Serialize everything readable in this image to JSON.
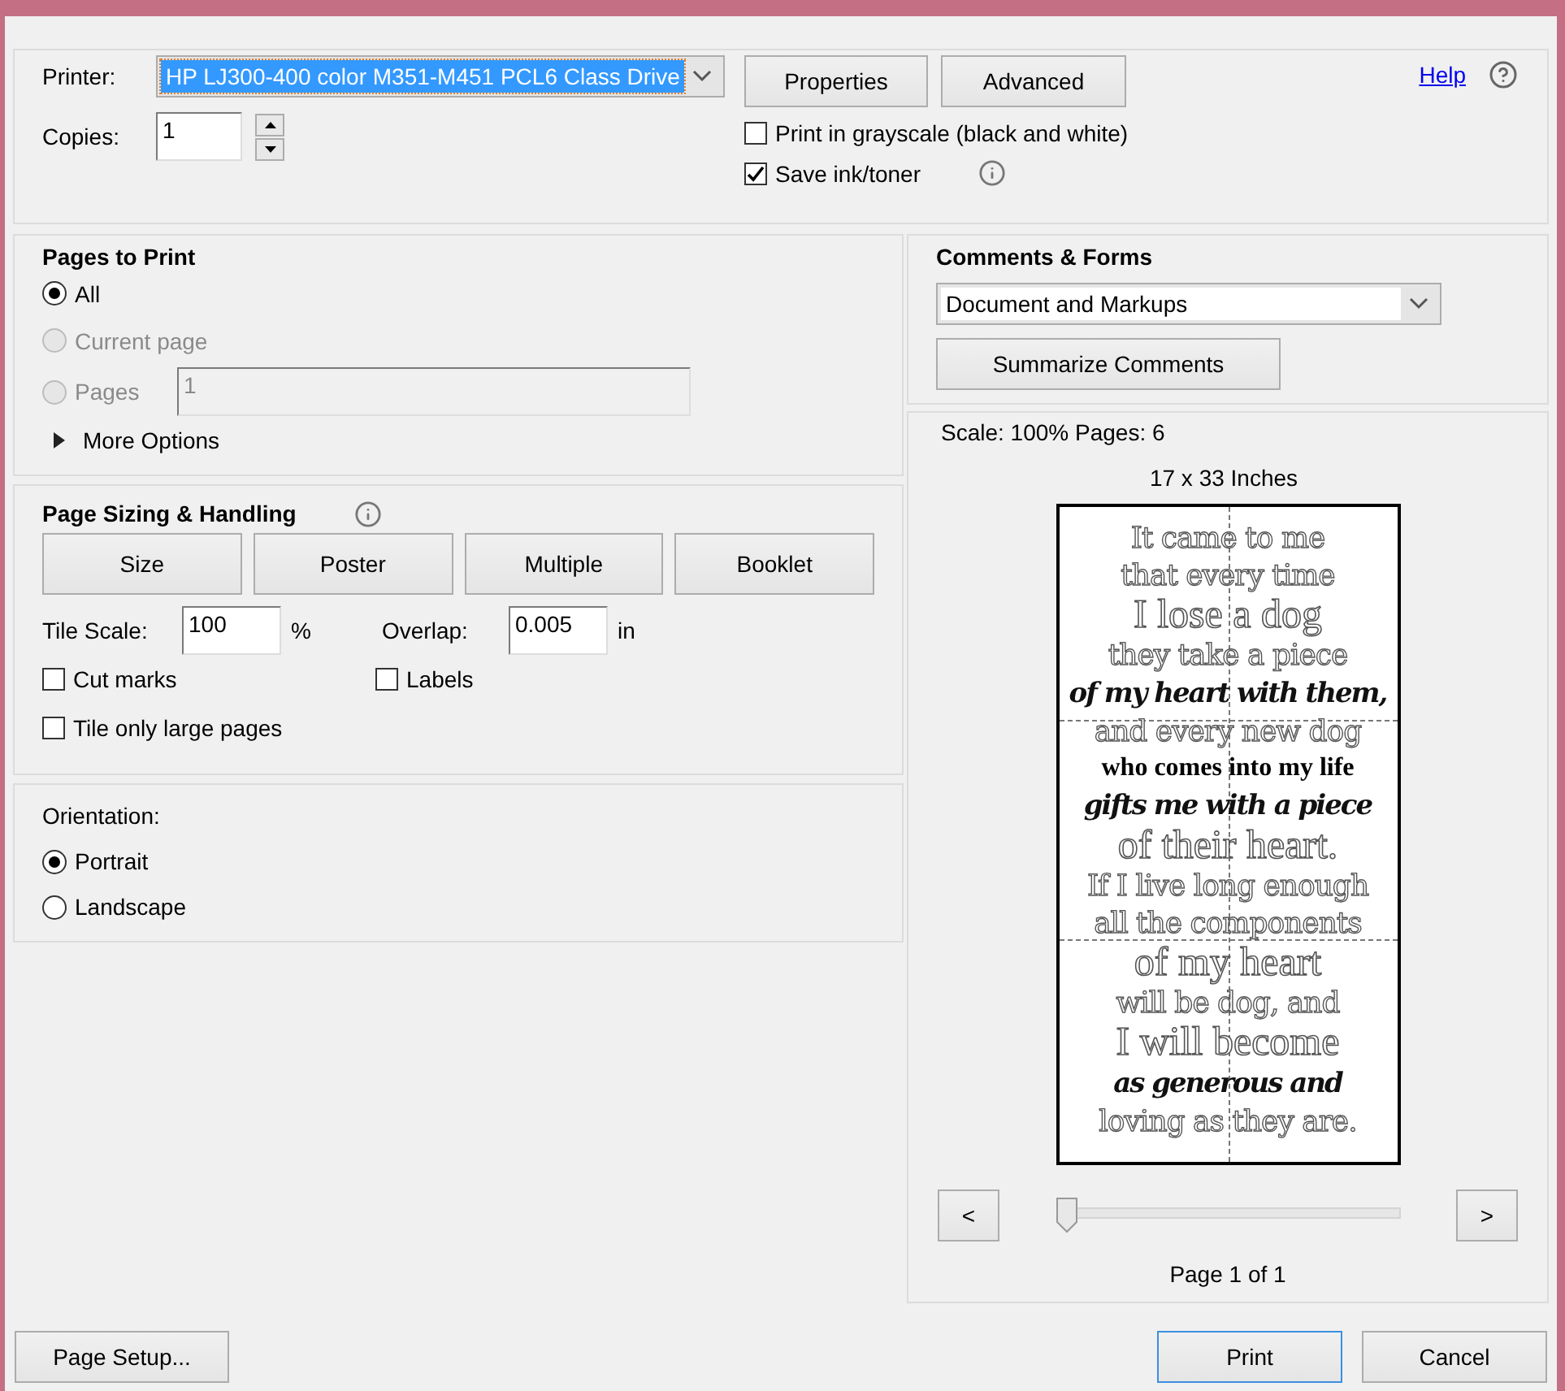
{
  "printer": {
    "label": "Printer:",
    "value": "HP LJ300-400 color M351-M451 PCL6 Class Drive"
  },
  "top_buttons": [
    "Properties",
    "Advanced"
  ],
  "help_link": "Help",
  "copies": {
    "label": "Copies:",
    "value": "1"
  },
  "print_options": [
    {
      "label": "Print in grayscale (black and white)",
      "checked": false,
      "info": false
    },
    {
      "label": "Save ink/toner",
      "checked": true,
      "info": true
    }
  ],
  "pages_to_print": {
    "title": "Pages to Print",
    "options": [
      {
        "label": "All",
        "selected": true,
        "disabled": false
      },
      {
        "label": "Current page",
        "selected": false,
        "disabled": true
      },
      {
        "label": "Pages",
        "selected": false,
        "disabled": true,
        "value": "1"
      }
    ],
    "more_options": {
      "label": "More Options",
      "expanded": false
    }
  },
  "page_sizing": {
    "title": "Page Sizing & Handling",
    "modes": [
      "Size",
      "Poster",
      "Multiple",
      "Booklet"
    ],
    "tile_scale": {
      "label": "Tile Scale:",
      "value": "100",
      "unit": "%"
    },
    "overlap": {
      "label": "Overlap:",
      "value": "0.005",
      "unit": "in"
    },
    "checkboxes": [
      {
        "label": "Cut marks",
        "checked": false
      },
      {
        "label": "Labels",
        "checked": false
      },
      {
        "label": "Tile only large pages",
        "checked": false
      }
    ]
  },
  "orientation": {
    "title": "Orientation:",
    "options": [
      {
        "label": "Portrait",
        "selected": true
      },
      {
        "label": "Landscape",
        "selected": false
      }
    ]
  },
  "comments_forms": {
    "title": "Comments & Forms",
    "value": "Document and Markups",
    "button": "Summarize Comments"
  },
  "preview": {
    "scale_info": "Scale: 100% Pages: 6",
    "paper_size": "17 x 33 Inches",
    "lines": [
      {
        "text": "It came to me",
        "kind": "outline"
      },
      {
        "text": "that every time",
        "kind": "outline"
      },
      {
        "text": "I lose a dog",
        "kind": "display"
      },
      {
        "text": "they take a piece",
        "kind": "outline"
      },
      {
        "text": "of my heart with them,",
        "kind": "script"
      },
      {
        "text": "and every new dog",
        "kind": "outline"
      },
      {
        "text": "who comes into my life",
        "kind": "solid"
      },
      {
        "text": "gifts me with a piece",
        "kind": "script"
      },
      {
        "text": "of their heart.",
        "kind": "display"
      },
      {
        "text": "If I live long enough",
        "kind": "outline"
      },
      {
        "text": "all the components",
        "kind": "outline"
      },
      {
        "text": "of my heart",
        "kind": "display"
      },
      {
        "text": "will be dog, and",
        "kind": "outline"
      },
      {
        "text": "I will become",
        "kind": "display"
      },
      {
        "text": "as generous and",
        "kind": "script"
      },
      {
        "text": "loving as they are.",
        "kind": "outline"
      }
    ],
    "prev": "<",
    "next": ">",
    "slider": {
      "level": 0
    },
    "page_label": "Page 1 of 1"
  },
  "footer": {
    "page_setup": "Page Setup...",
    "print": "Print",
    "cancel": "Cancel"
  }
}
